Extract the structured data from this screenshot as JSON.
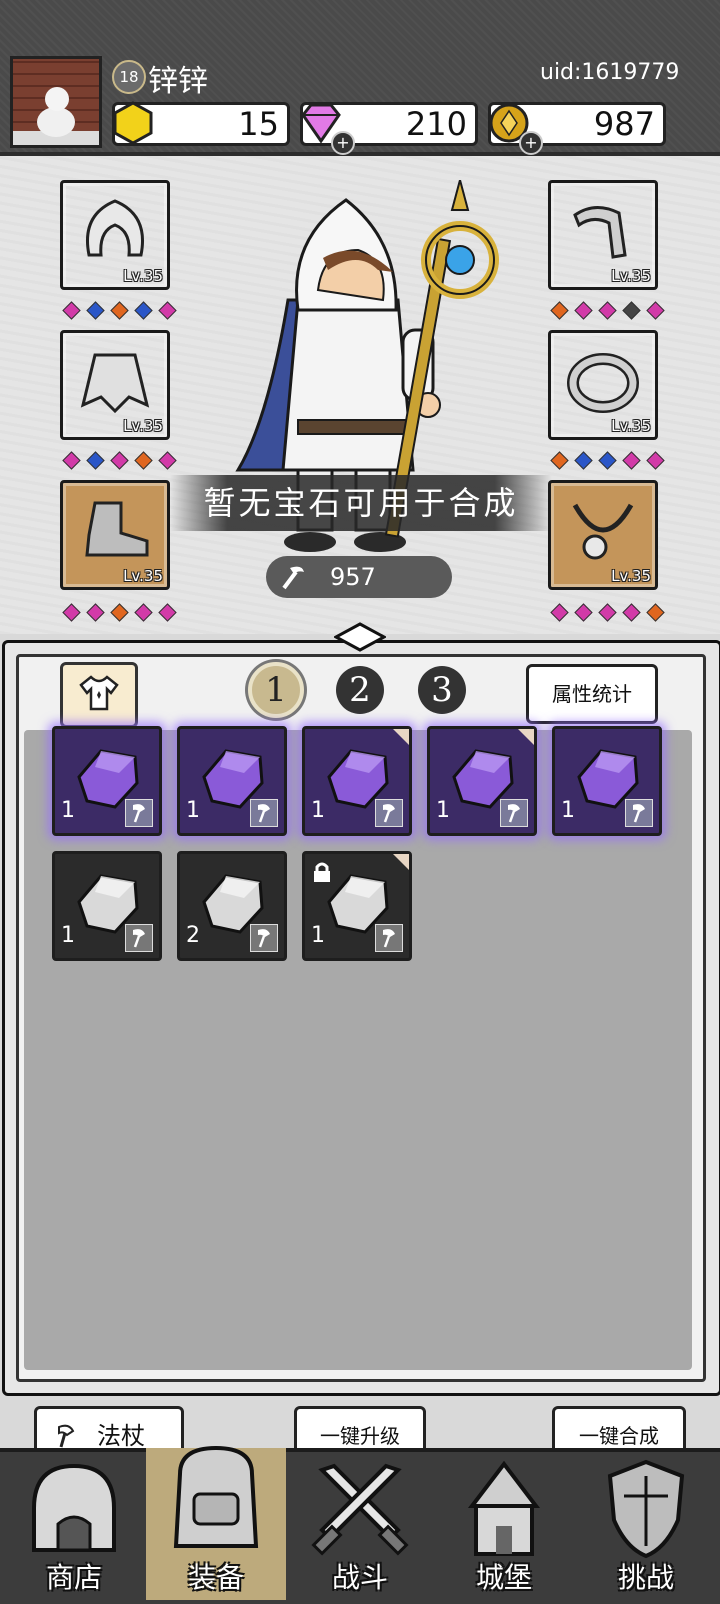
{
  "player": {
    "level": "18",
    "name": "锌锌",
    "uid": "uid:1619779"
  },
  "resources": {
    "gold_gem": "15",
    "diamond": "210",
    "coin": "987"
  },
  "equipment": {
    "left": [
      {
        "icon": "hood-icon",
        "level": "Lv.35",
        "rarity": "purple",
        "gems": [
          "#d23aa8",
          "#2a56c8",
          "#e0661f",
          "#2a56c8",
          "#d23aa8"
        ]
      },
      {
        "icon": "cape-icon",
        "level": "Lv.35",
        "rarity": "purple",
        "gems": [
          "#d23aa8",
          "#2a56c8",
          "#d23aa8",
          "#e0661f",
          "#d23aa8"
        ]
      },
      {
        "icon": "boot-icon",
        "level": "Lv.35",
        "rarity": "orange",
        "gems": [
          "#d23aa8",
          "#d23aa8",
          "#e0661f",
          "#d23aa8",
          "#d23aa8"
        ]
      }
    ],
    "right": [
      {
        "icon": "staff-weapon-icon",
        "level": "Lv.35",
        "rarity": "purple",
        "gems": [
          "#e0661f",
          "#d23aa8",
          "#d23aa8",
          "#444444",
          "#d23aa8"
        ]
      },
      {
        "icon": "ring-icon",
        "level": "Lv.35",
        "rarity": "purple",
        "gems": [
          "#e0661f",
          "#2a56c8",
          "#2a56c8",
          "#d23aa8",
          "#d23aa8"
        ]
      },
      {
        "icon": "necklace-icon",
        "level": "Lv.35",
        "rarity": "orange",
        "gems": [
          "#d23aa8",
          "#d23aa8",
          "#d23aa8",
          "#d23aa8",
          "#e0661f"
        ]
      }
    ]
  },
  "banner": {
    "message": "暂无宝石可用于合成"
  },
  "power": {
    "value": "957"
  },
  "inventory": {
    "pages": [
      "1",
      "2",
      "3"
    ],
    "active_page": "1",
    "stats_button": "属性统计",
    "items": [
      {
        "type": "purple-gem-icon",
        "count": "1",
        "corner": false,
        "locked": false
      },
      {
        "type": "purple-gem-icon",
        "count": "1",
        "corner": false,
        "locked": false
      },
      {
        "type": "purple-gem-icon",
        "count": "1",
        "corner": true,
        "locked": false
      },
      {
        "type": "purple-gem-icon",
        "count": "1",
        "corner": true,
        "locked": false
      },
      {
        "type": "purple-gem-icon",
        "count": "1",
        "corner": false,
        "locked": false
      },
      {
        "type": "silver-gem-icon",
        "count": "1",
        "corner": false,
        "locked": false
      },
      {
        "type": "silver-gem-icon",
        "count": "2",
        "corner": false,
        "locked": false
      },
      {
        "type": "silver-gem-icon",
        "count": "1",
        "corner": true,
        "locked": true
      }
    ]
  },
  "actions": {
    "filter": "法杖",
    "upgrade_all": "一键升级",
    "merge_all": "一键合成"
  },
  "nav": [
    {
      "label": "商店",
      "icon": "shop-icon"
    },
    {
      "label": "装备",
      "icon": "backpack-icon",
      "active": true
    },
    {
      "label": "战斗",
      "icon": "crossed-swords-icon"
    },
    {
      "label": "城堡",
      "icon": "castle-icon"
    },
    {
      "label": "挑战",
      "icon": "shield-icon"
    }
  ]
}
